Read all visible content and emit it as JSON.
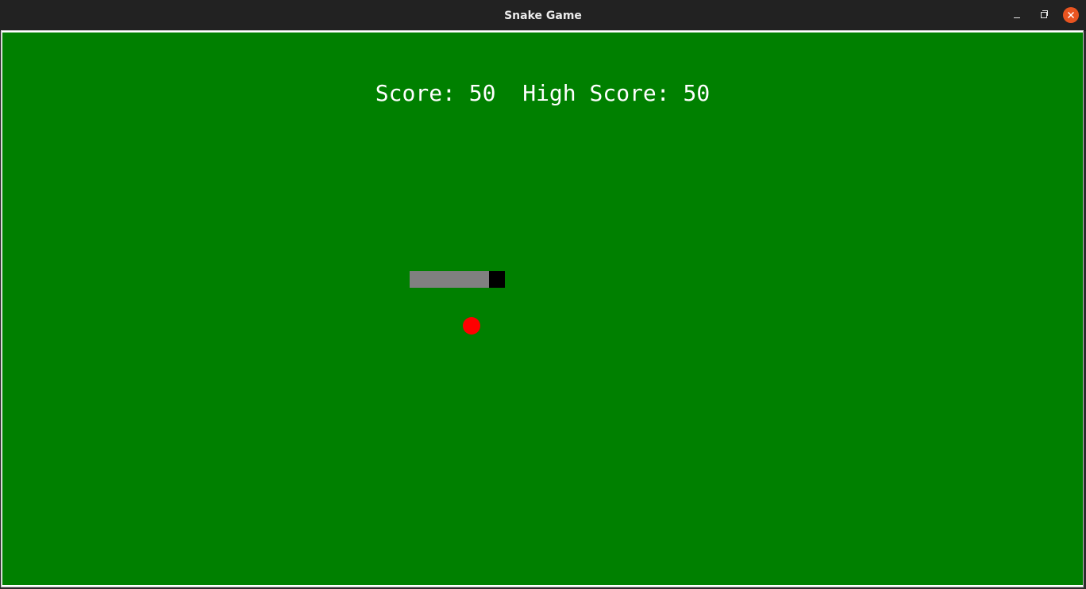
{
  "window": {
    "title": "Snake Game",
    "controls": {
      "minimize": "minimize-icon",
      "maximize": "maximize-icon",
      "close": "close-icon"
    }
  },
  "game": {
    "score_label": "Score:",
    "score": "50",
    "high_score_label": "High Score:",
    "high_score": "50",
    "colors": {
      "background": "#008000",
      "snake_head": "#000000",
      "snake_body": "#808080",
      "food": "#ff0000",
      "text": "#ffffff"
    },
    "snake_length": 6,
    "direction": "right"
  }
}
